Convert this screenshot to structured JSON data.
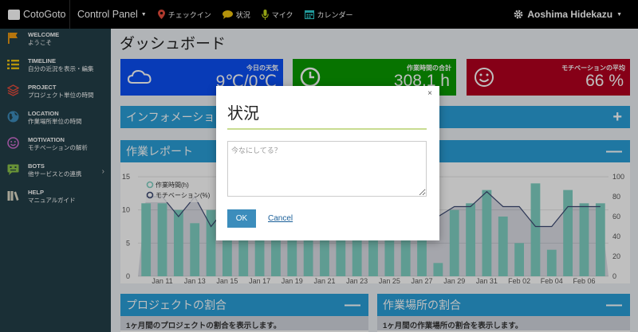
{
  "topbar": {
    "brand": "CotoGoto",
    "control_panel": "Control Panel",
    "checkin": "チェックイン",
    "status": "状況",
    "mic": "マイク",
    "calendar": "カレンダー",
    "user": "Aoshima Hidekazu"
  },
  "sidebar": {
    "items": [
      {
        "en": "WELCOME",
        "ja": "ようこそ",
        "icon": "flag-icon",
        "color": "#f39c12"
      },
      {
        "en": "TIMELINE",
        "ja": "自分の近況を表示・編集",
        "icon": "list-icon",
        "color": "#f1c40f"
      },
      {
        "en": "PROJECT",
        "ja": "プロジェクト単位の時間",
        "icon": "layers-icon",
        "color": "#e74c3c"
      },
      {
        "en": "LOCATION",
        "ja": "作業場所単位の時間",
        "icon": "globe-icon",
        "color": "#3c8dbc"
      },
      {
        "en": "MOTIVATION",
        "ja": "モチベーションの解析",
        "icon": "smile-icon",
        "color": "#d56fd5"
      },
      {
        "en": "BOTS",
        "ja": "他サービスとの連携",
        "icon": "bot-icon",
        "color": "#8bc34a"
      },
      {
        "en": "HELP",
        "ja": "マニュアルガイド",
        "icon": "books-icon",
        "color": "#e0dcc9"
      }
    ]
  },
  "main": {
    "title": "ダッシュボード",
    "weather": {
      "label": "今日の天気",
      "value": "9℃/0℃",
      "color": "#0b4ff5"
    },
    "work_total": {
      "label": "作業時間の合計",
      "value": "308.1 h",
      "color": "#0a9a00"
    },
    "motivation_avg": {
      "label": "モチベーションの平均",
      "value": "66 %",
      "color": "#b3001f"
    },
    "info_panel": {
      "title": "インフォメーション",
      "btn": "+"
    },
    "report_panel": {
      "title": "作業レポート",
      "btn": "—"
    },
    "project_panel": {
      "title": "プロジェクトの割合",
      "btn": "—",
      "sub": "1ヶ月間のプロジェクトの割合を表示します。"
    },
    "location_panel": {
      "title": "作業場所の割合",
      "btn": "—",
      "sub": "1ヶ月間の作業場所の割合を表示します。"
    }
  },
  "chart_data": {
    "type": "bar",
    "x": [
      "Jan 10",
      "Jan 11",
      "Jan 12",
      "Jan 13",
      "Jan 14",
      "Jan 15",
      "Jan 16",
      "Jan 17",
      "Jan 18",
      "Jan 19",
      "Jan 20",
      "Jan 21",
      "Jan 22",
      "Jan 23",
      "Jan 24",
      "Jan 25",
      "Jan 26",
      "Jan 27",
      "Jan 28",
      "Jan 29",
      "Jan 30",
      "Jan 31",
      "Feb 01",
      "Feb 02",
      "Feb 03",
      "Feb 04",
      "Feb 05",
      "Feb 06",
      "Feb 07"
    ],
    "x_ticks": [
      "Jan 11",
      "Jan 13",
      "Jan 15",
      "Jan 17",
      "Jan 19",
      "Jan 21",
      "Jan 23",
      "Jan 25",
      "Jan 27",
      "Jan 29",
      "Jan 31",
      "Feb 02",
      "Feb 04",
      "Feb 06"
    ],
    "series": [
      {
        "name": "作業時間(h)",
        "axis": "left",
        "color": "#7fd1c3",
        "values": [
          11,
          11,
          10,
          8,
          10,
          9,
          8,
          9,
          9,
          9,
          10,
          10,
          9,
          8,
          9,
          10,
          9,
          11,
          2,
          10,
          11,
          13,
          9,
          5,
          14,
          4,
          13,
          11,
          11
        ]
      },
      {
        "name": "モチベーション(%)",
        "axis": "right",
        "color": "#3d4a73",
        "values": [
          80,
          80,
          60,
          80,
          50,
          70,
          60,
          70,
          70,
          60,
          60,
          70,
          70,
          60,
          70,
          60,
          60,
          60,
          60,
          70,
          70,
          85,
          70,
          70,
          50,
          50,
          70,
          70,
          70
        ]
      }
    ],
    "y_left": {
      "ticks": [
        0,
        5,
        10,
        15
      ],
      "range": [
        0,
        15
      ]
    },
    "y_right": {
      "ticks": [
        0,
        20,
        40,
        60,
        80,
        100
      ],
      "range": [
        0,
        100
      ]
    },
    "legend": "top-left"
  },
  "modal": {
    "title": "状況",
    "close": "×",
    "placeholder": "今なにしてる？",
    "ok": "OK",
    "cancel": "Cancel"
  }
}
